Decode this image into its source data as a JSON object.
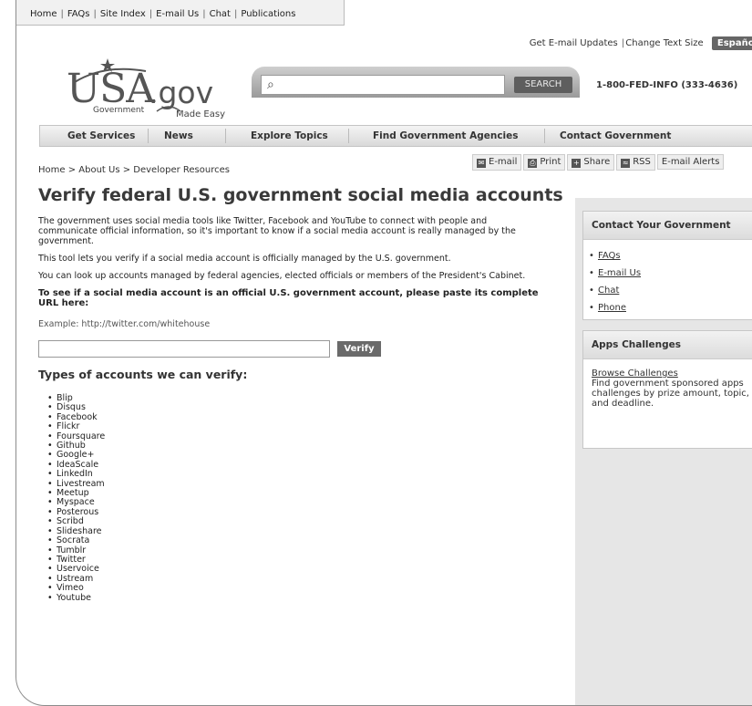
{
  "topbar": {
    "links": [
      "Home",
      "FAQs",
      "Site Index",
      "E-mail Us",
      "Chat",
      "Publications"
    ]
  },
  "utility": {
    "email_updates": "Get E-mail Updates",
    "text_size": "Change Text Size",
    "espanol": "Español"
  },
  "logo": {
    "main": "USA",
    "suffix": ".gov",
    "tagline1": "Government",
    "tagline2": "Made Easy"
  },
  "search": {
    "placeholder": "",
    "button": "SEARCH"
  },
  "phone": "1-800-FED-INFO (333-4636)",
  "nav": [
    "Get Services",
    "News",
    "Explore Topics",
    "Find Government Agencies",
    "Contact Government"
  ],
  "breadcrumb": "Home > About Us > Developer Resources",
  "share": {
    "email": "E-mail",
    "print": "Print",
    "share": "Share",
    "rss": "RSS",
    "alerts": "E-mail Alerts"
  },
  "main": {
    "title": "Verify federal U.S. government social media accounts",
    "p1": "The government uses social media tools like Twitter, Facebook and YouTube to connect with people and communicate official information, so it's important to know if a social media account is really managed by the government.",
    "p2": "This tool lets you verify if a social media account is officially managed by the U.S. government.",
    "p3": "You can look up accounts managed by federal agencies, elected officials or members of the President's Cabinet.",
    "prompt": "To see if a social media account is an official U.S. government account, please paste its complete URL here:",
    "example": "Example: http://twitter.com/whitehouse",
    "url_value": "",
    "verify_button": "Verify",
    "types_heading": "Types of accounts we can verify:",
    "types": [
      "Blip",
      "Disqus",
      "Facebook",
      "Flickr",
      "Foursquare",
      "Github",
      "Google+",
      "IdeaScale",
      "LinkedIn",
      "Livestream",
      "Meetup",
      "Myspace",
      "Posterous",
      "Scribd",
      "Slideshare",
      "Socrata",
      "Tumblr",
      "Twitter",
      "Uservoice",
      "Ustream",
      "Vimeo",
      "Youtube"
    ]
  },
  "sidebar": {
    "contact": {
      "heading": "Contact Your Government",
      "links": [
        "FAQs",
        "E-mail Us",
        "Chat",
        "Phone"
      ]
    },
    "apps": {
      "heading": "Apps Challenges",
      "link": "Browse Challenges",
      "text": "Find government sponsored apps challenges by prize amount, topic, and deadline."
    }
  }
}
